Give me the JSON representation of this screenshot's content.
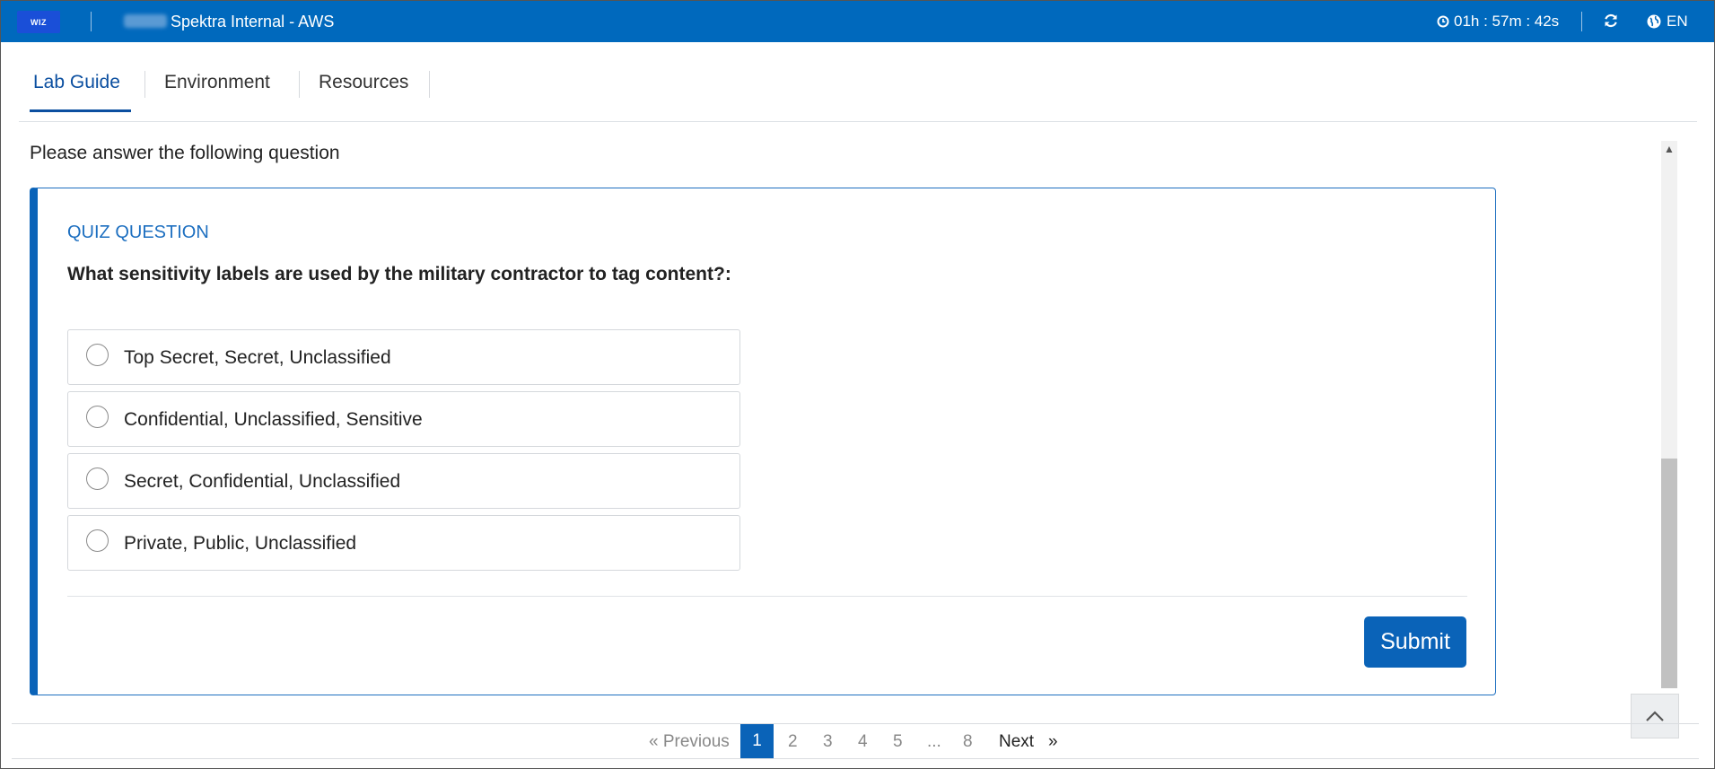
{
  "header": {
    "logo_text": "WIZ",
    "app_title": "Spektra Internal - AWS",
    "timer": "01h : 57m : 42s",
    "language": "EN",
    "colors": {
      "bar": "#0069bd",
      "accent": "#0a63b8"
    }
  },
  "tabs": [
    {
      "label": "Lab Guide",
      "active": true
    },
    {
      "label": "Environment",
      "active": false
    },
    {
      "label": "Resources",
      "active": false
    }
  ],
  "content": {
    "intro": "Please answer the following question",
    "quiz": {
      "label": "QUIZ QUESTION",
      "question": "What sensitivity labels are used by the military contractor to tag content?:",
      "options": [
        "Top Secret, Secret, Unclassified",
        "Confidential, Unclassified, Sensitive",
        "Secret, Confidential, Unclassified",
        "Private, Public, Unclassified"
      ],
      "submit_label": "Submit"
    }
  },
  "pagination": {
    "previous": "« Previous",
    "pages": [
      "1",
      "2",
      "3",
      "4",
      "5",
      "...",
      "8"
    ],
    "current": "1",
    "next": "Next",
    "next_arrow": "»"
  },
  "icons": [
    "clock-icon",
    "refresh-icon",
    "globe-icon",
    "chevron-up-icon",
    "scroll-up-arrow-icon"
  ]
}
